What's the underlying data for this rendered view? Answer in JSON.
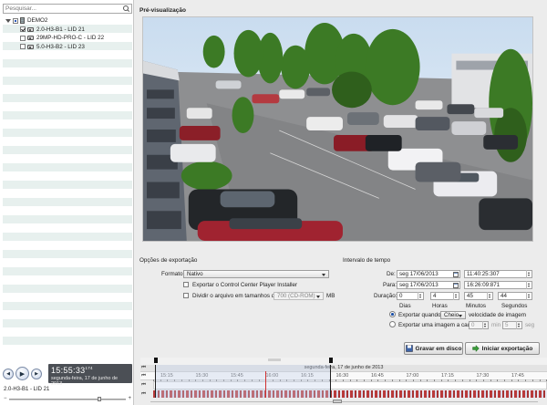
{
  "search": {
    "placeholder": "Pesquisar..."
  },
  "tree": {
    "root": "DEMO2",
    "cameras": [
      {
        "label": "2.0-H3-B1 - LID 21",
        "checked": true
      },
      {
        "label": "29MP-HD-PRO-C - LID 22",
        "checked": false
      },
      {
        "label": "5.0-H3-B2 - LID 23",
        "checked": false
      }
    ]
  },
  "player": {
    "time": "15:55:33",
    "time_ms": "174",
    "date": "segunda-feira, 17 de junho de 2013",
    "camera_label": "2.0-H3-B1 - LID 21"
  },
  "preview": {
    "title": "Pré-visualização"
  },
  "export_options": {
    "title": "Opções de exportação",
    "format_label": "Formato:",
    "format_value": "Nativo",
    "export_installer_label": "Exportar o Control Center Player Installer",
    "split_label": "Dividir o arquivo em tamanhos de:",
    "split_value": "700 (CD-ROM)",
    "split_unit": "MB"
  },
  "time_interval": {
    "title": "Intervalo de tempo",
    "from_label": "De:",
    "from_date": "seg 17/06/2013",
    "from_time": "11:40:25:307",
    "to_label": "Para:",
    "to_date": "seg 17/06/2013",
    "to_time": "16:26:09:871",
    "duration_label": "Duração:",
    "days": "0",
    "hours": "4",
    "minutes": "45",
    "seconds": "44",
    "days_label": "Dias",
    "hours_label": "Horas",
    "minutes_label": "Minutos",
    "seconds_label": "Segundos",
    "export_when_label": "Exportar quando",
    "export_when_value": "Cheio",
    "speed_label": "velocidade de imagem",
    "export_one_label": "Exportar uma imagem a cada",
    "min_value": "0",
    "min_label": "min",
    "seg_value": "5",
    "seg_label": "seg"
  },
  "buttons": {
    "save_disk": "Gravar em disco",
    "start_export": "Iniciar exportação"
  },
  "timeline": {
    "date": "segunda-feira, 17 de junho de 2013",
    "ticks": [
      "15:15",
      "15:30",
      "15:45",
      "16:00",
      "16:15",
      "16:30",
      "16:45",
      "17:00",
      "17:15",
      "17:30",
      "17:45"
    ]
  },
  "colors": {
    "accent": "#1a4fa8",
    "recording": "#b93a3a",
    "clock_bg": "#4b4f55"
  }
}
